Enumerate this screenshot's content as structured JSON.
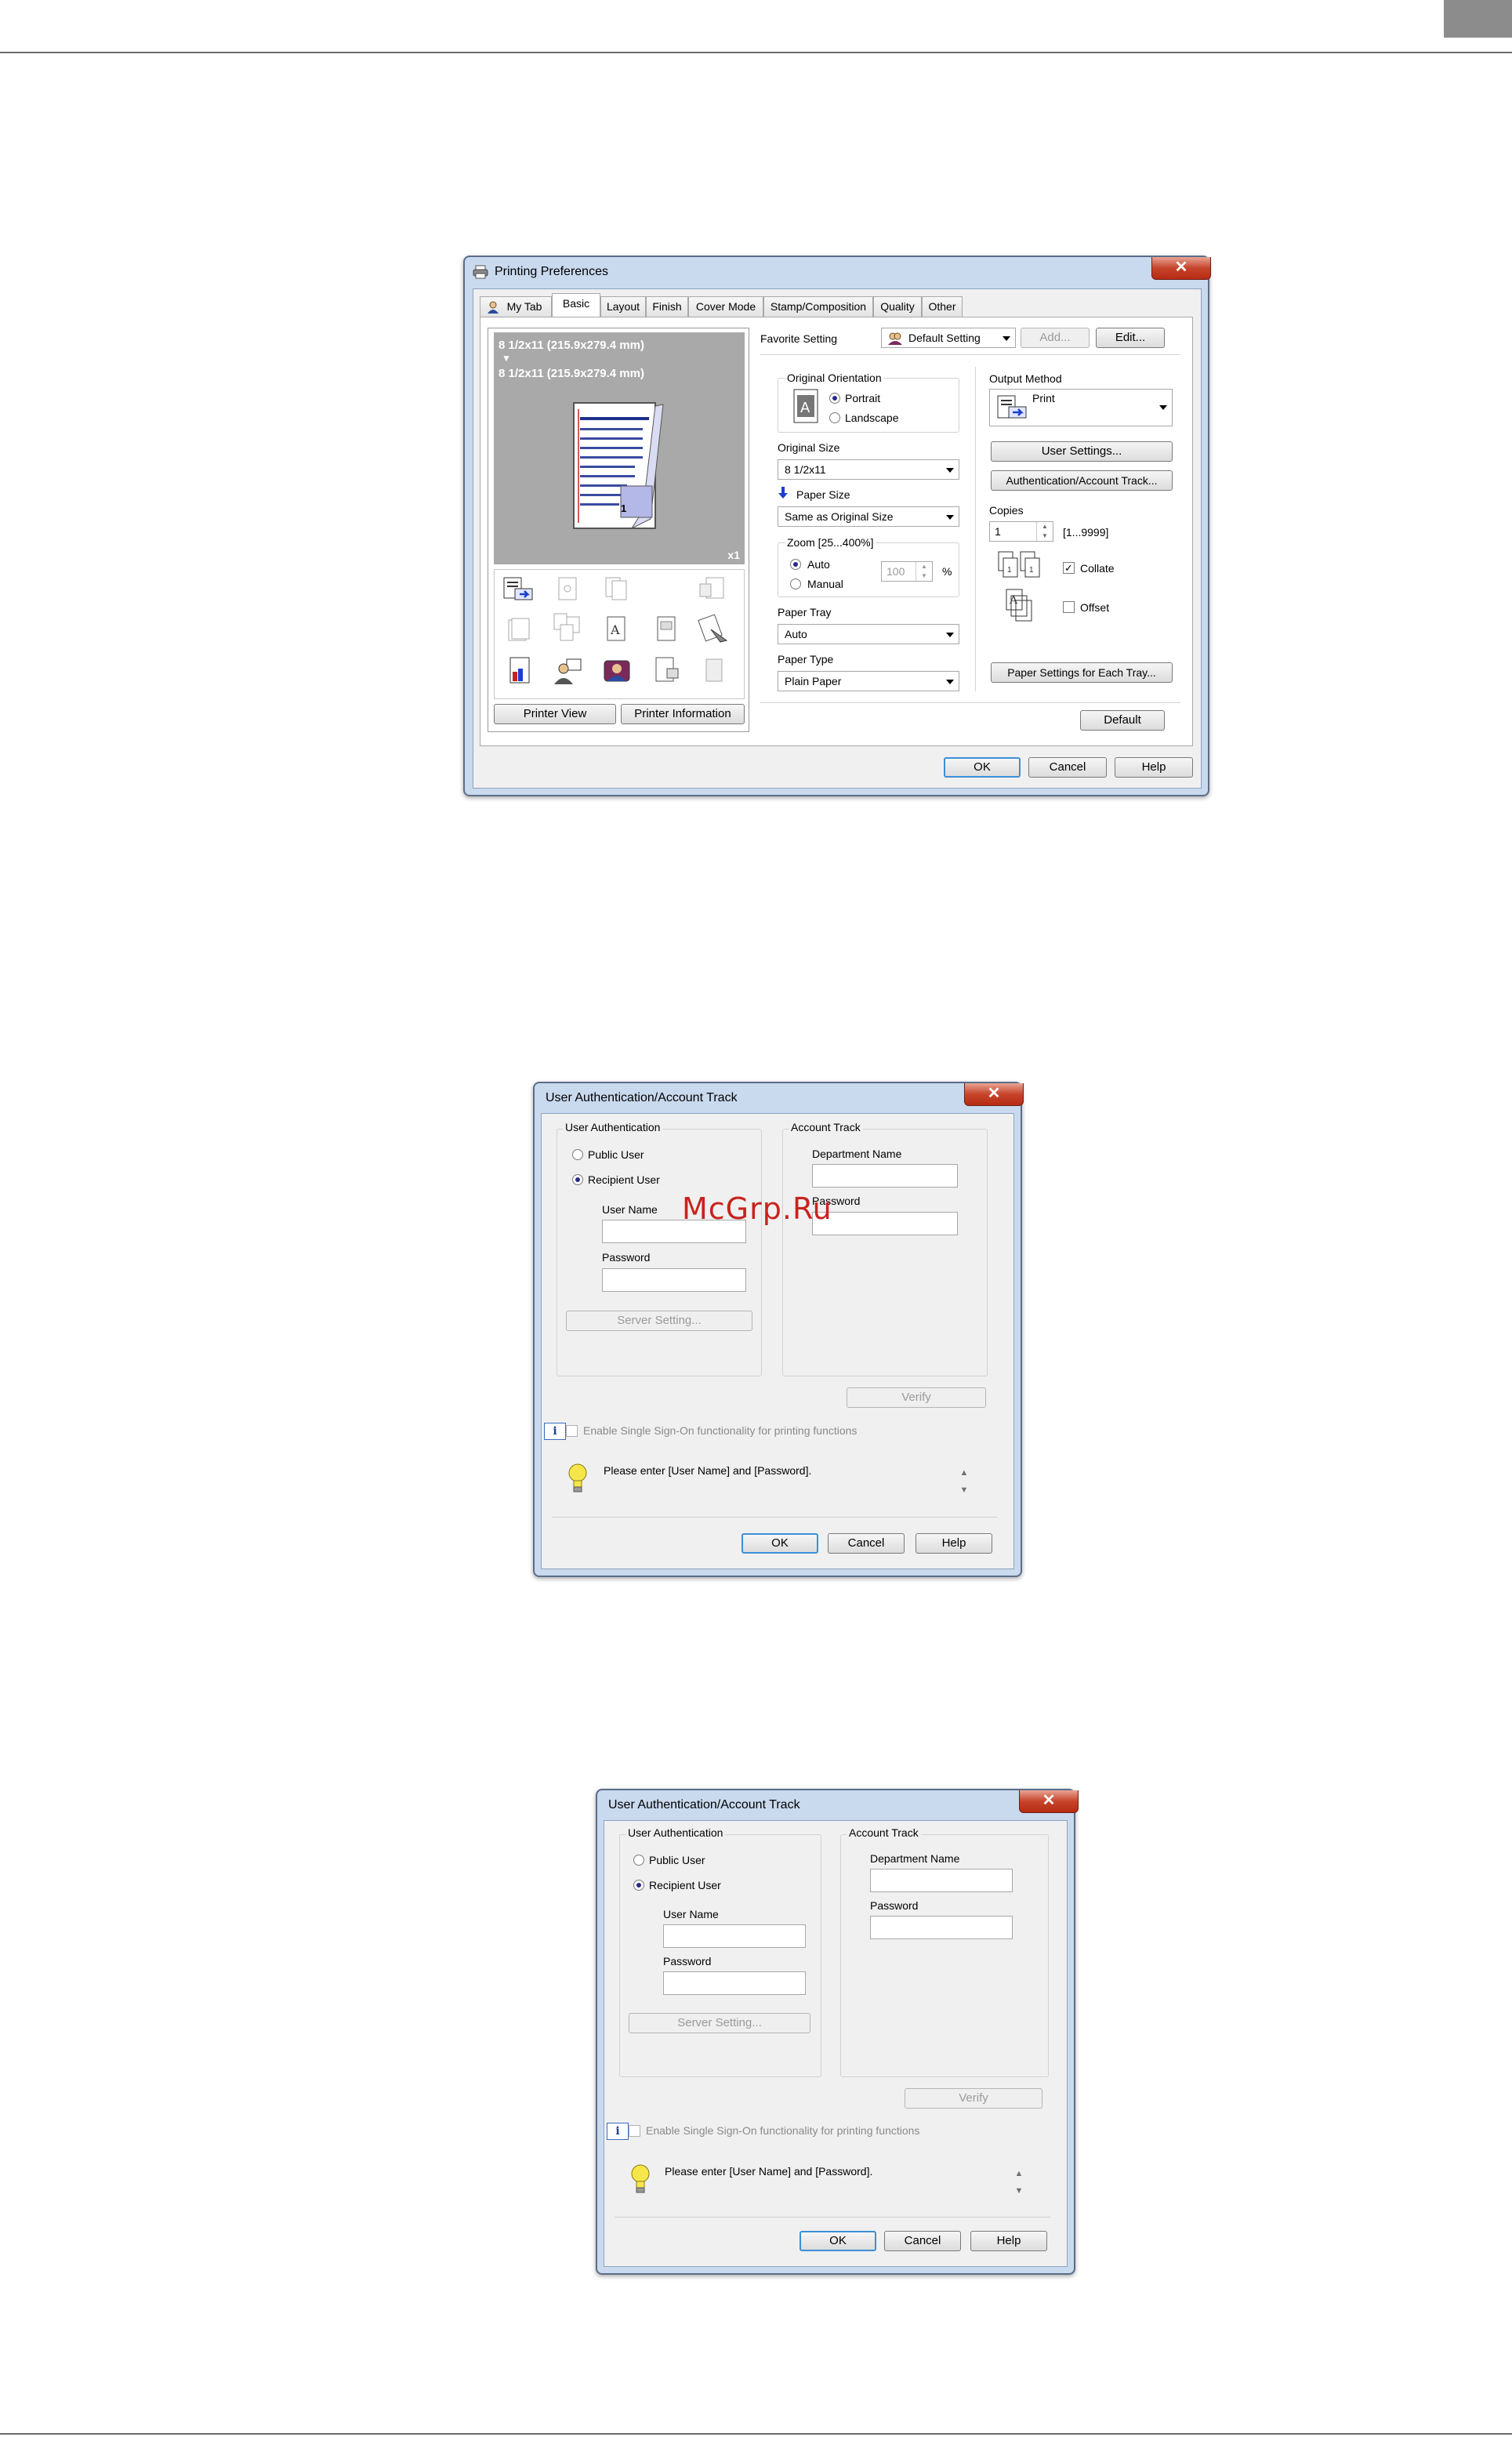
{
  "printing_preferences": {
    "title": "Printing Preferences",
    "close": "✕",
    "tabs": [
      "My Tab",
      "Basic",
      "Layout",
      "Finish",
      "Cover Mode",
      "Stamp/Composition",
      "Quality",
      "Other"
    ],
    "preview": {
      "line1": "8 1/2x11 (215.9x279.4 mm)",
      "arrow": "▼",
      "line2": "8 1/2x11 (215.9x279.4 mm)",
      "count": "x1",
      "page_num": "1"
    },
    "printer_view": "Printer View",
    "printer_information": "Printer Information",
    "favorite_setting_label": "Favorite Setting",
    "favorite_setting_value": "Default Setting",
    "add_button": "Add...",
    "edit_button": "Edit...",
    "original_orientation": "Original Orientation",
    "portrait": "Portrait",
    "landscape": "Landscape",
    "original_size_label": "Original Size",
    "original_size_value": "8 1/2x11",
    "paper_size_label": "Paper Size",
    "paper_size_value": "Same as Original Size",
    "zoom_label": "Zoom [25...400%]",
    "zoom_auto": "Auto",
    "zoom_manual": "Manual",
    "zoom_value": "100",
    "zoom_unit": "%",
    "paper_tray_label": "Paper Tray",
    "paper_tray_value": "Auto",
    "paper_type_label": "Paper Type",
    "paper_type_value": "Plain Paper",
    "output_method_label": "Output Method",
    "output_method_value": "Print",
    "user_settings_button": "User Settings...",
    "auth_button": "Authentication/Account Track...",
    "copies_label": "Copies",
    "copies_value": "1",
    "copies_range": "[1...9999]",
    "collate": "Collate",
    "offset": "Offset",
    "paper_settings_button": "Paper Settings for Each Tray...",
    "default_button": "Default",
    "ok": "OK",
    "cancel": "Cancel",
    "help": "Help"
  },
  "auth_dialog_1": {
    "title": "User Authentication/Account Track",
    "close": "✕",
    "user_auth_group": "User Authentication",
    "public_user": "Public User",
    "recipient_user": "Recipient User",
    "user_name_label": "User Name",
    "password_label": "Password",
    "server_setting_button": "Server Setting...",
    "account_track_group": "Account Track",
    "department_name_label": "Department Name",
    "account_password_label": "Password",
    "verify_button": "Verify",
    "info_icon": "i",
    "sso_label": "Enable Single Sign-On functionality for printing functions",
    "hint_text": "Please enter [User Name] and [Password].",
    "ok": "OK",
    "cancel": "Cancel",
    "help": "Help"
  },
  "auth_dialog_2": {
    "title": "User Authentication/Account Track",
    "close": "✕",
    "user_auth_group": "User Authentication",
    "public_user": "Public User",
    "recipient_user": "Recipient User",
    "user_name_label": "User Name",
    "password_label": "Password",
    "server_setting_button": "Server Setting...",
    "account_track_group": "Account Track",
    "department_name_label": "Department Name",
    "account_password_label": "Password",
    "verify_button": "Verify",
    "info_icon": "i",
    "sso_label": "Enable Single Sign-On functionality for printing functions",
    "hint_text": "Please enter [User Name] and [Password].",
    "ok": "OK",
    "cancel": "Cancel",
    "help": "Help"
  },
  "watermark": "McGrp.Ru",
  "colors": {
    "title_bar": "#c9d9ee",
    "close_button": "#c6442b",
    "preview_bg": "#a9a9a9",
    "accent": "#3c8fd6"
  },
  "icons": [
    "printer-icon",
    "close-icon",
    "user-icon",
    "favorite-icon",
    "portrait-page-icon",
    "blue-arrow-icon",
    "print-output-icon",
    "collate-icon",
    "offset-icon",
    "info-icon",
    "lightbulb-icon"
  ]
}
